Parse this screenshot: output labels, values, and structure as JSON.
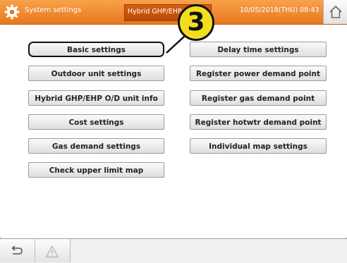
{
  "header": {
    "title": "System settings",
    "system_name": "Hybrid GHP/EHP",
    "datetime": "10/05/2018(THU) 08:43",
    "home_icon": "home-icon",
    "settings_icon": "gear-icon"
  },
  "callout": {
    "label": "3"
  },
  "buttons": {
    "left": [
      "Basic settings",
      "Outdoor unit settings",
      "Hybrid GHP/EHP O/D unit info",
      "Cost settings",
      "Gas demand settings",
      "Check upper limit map"
    ],
    "right": [
      "Delay time settings",
      "Register power demand point",
      "Register gas demand point",
      "Register hotwtr demand point",
      "Individual map settings"
    ]
  },
  "footer": {
    "back_icon": "back-arrow-icon",
    "alarm_icon": "warning-icon"
  },
  "colors": {
    "header_orange": "#f08a2c",
    "callout_yellow": "#f3dd1d"
  }
}
